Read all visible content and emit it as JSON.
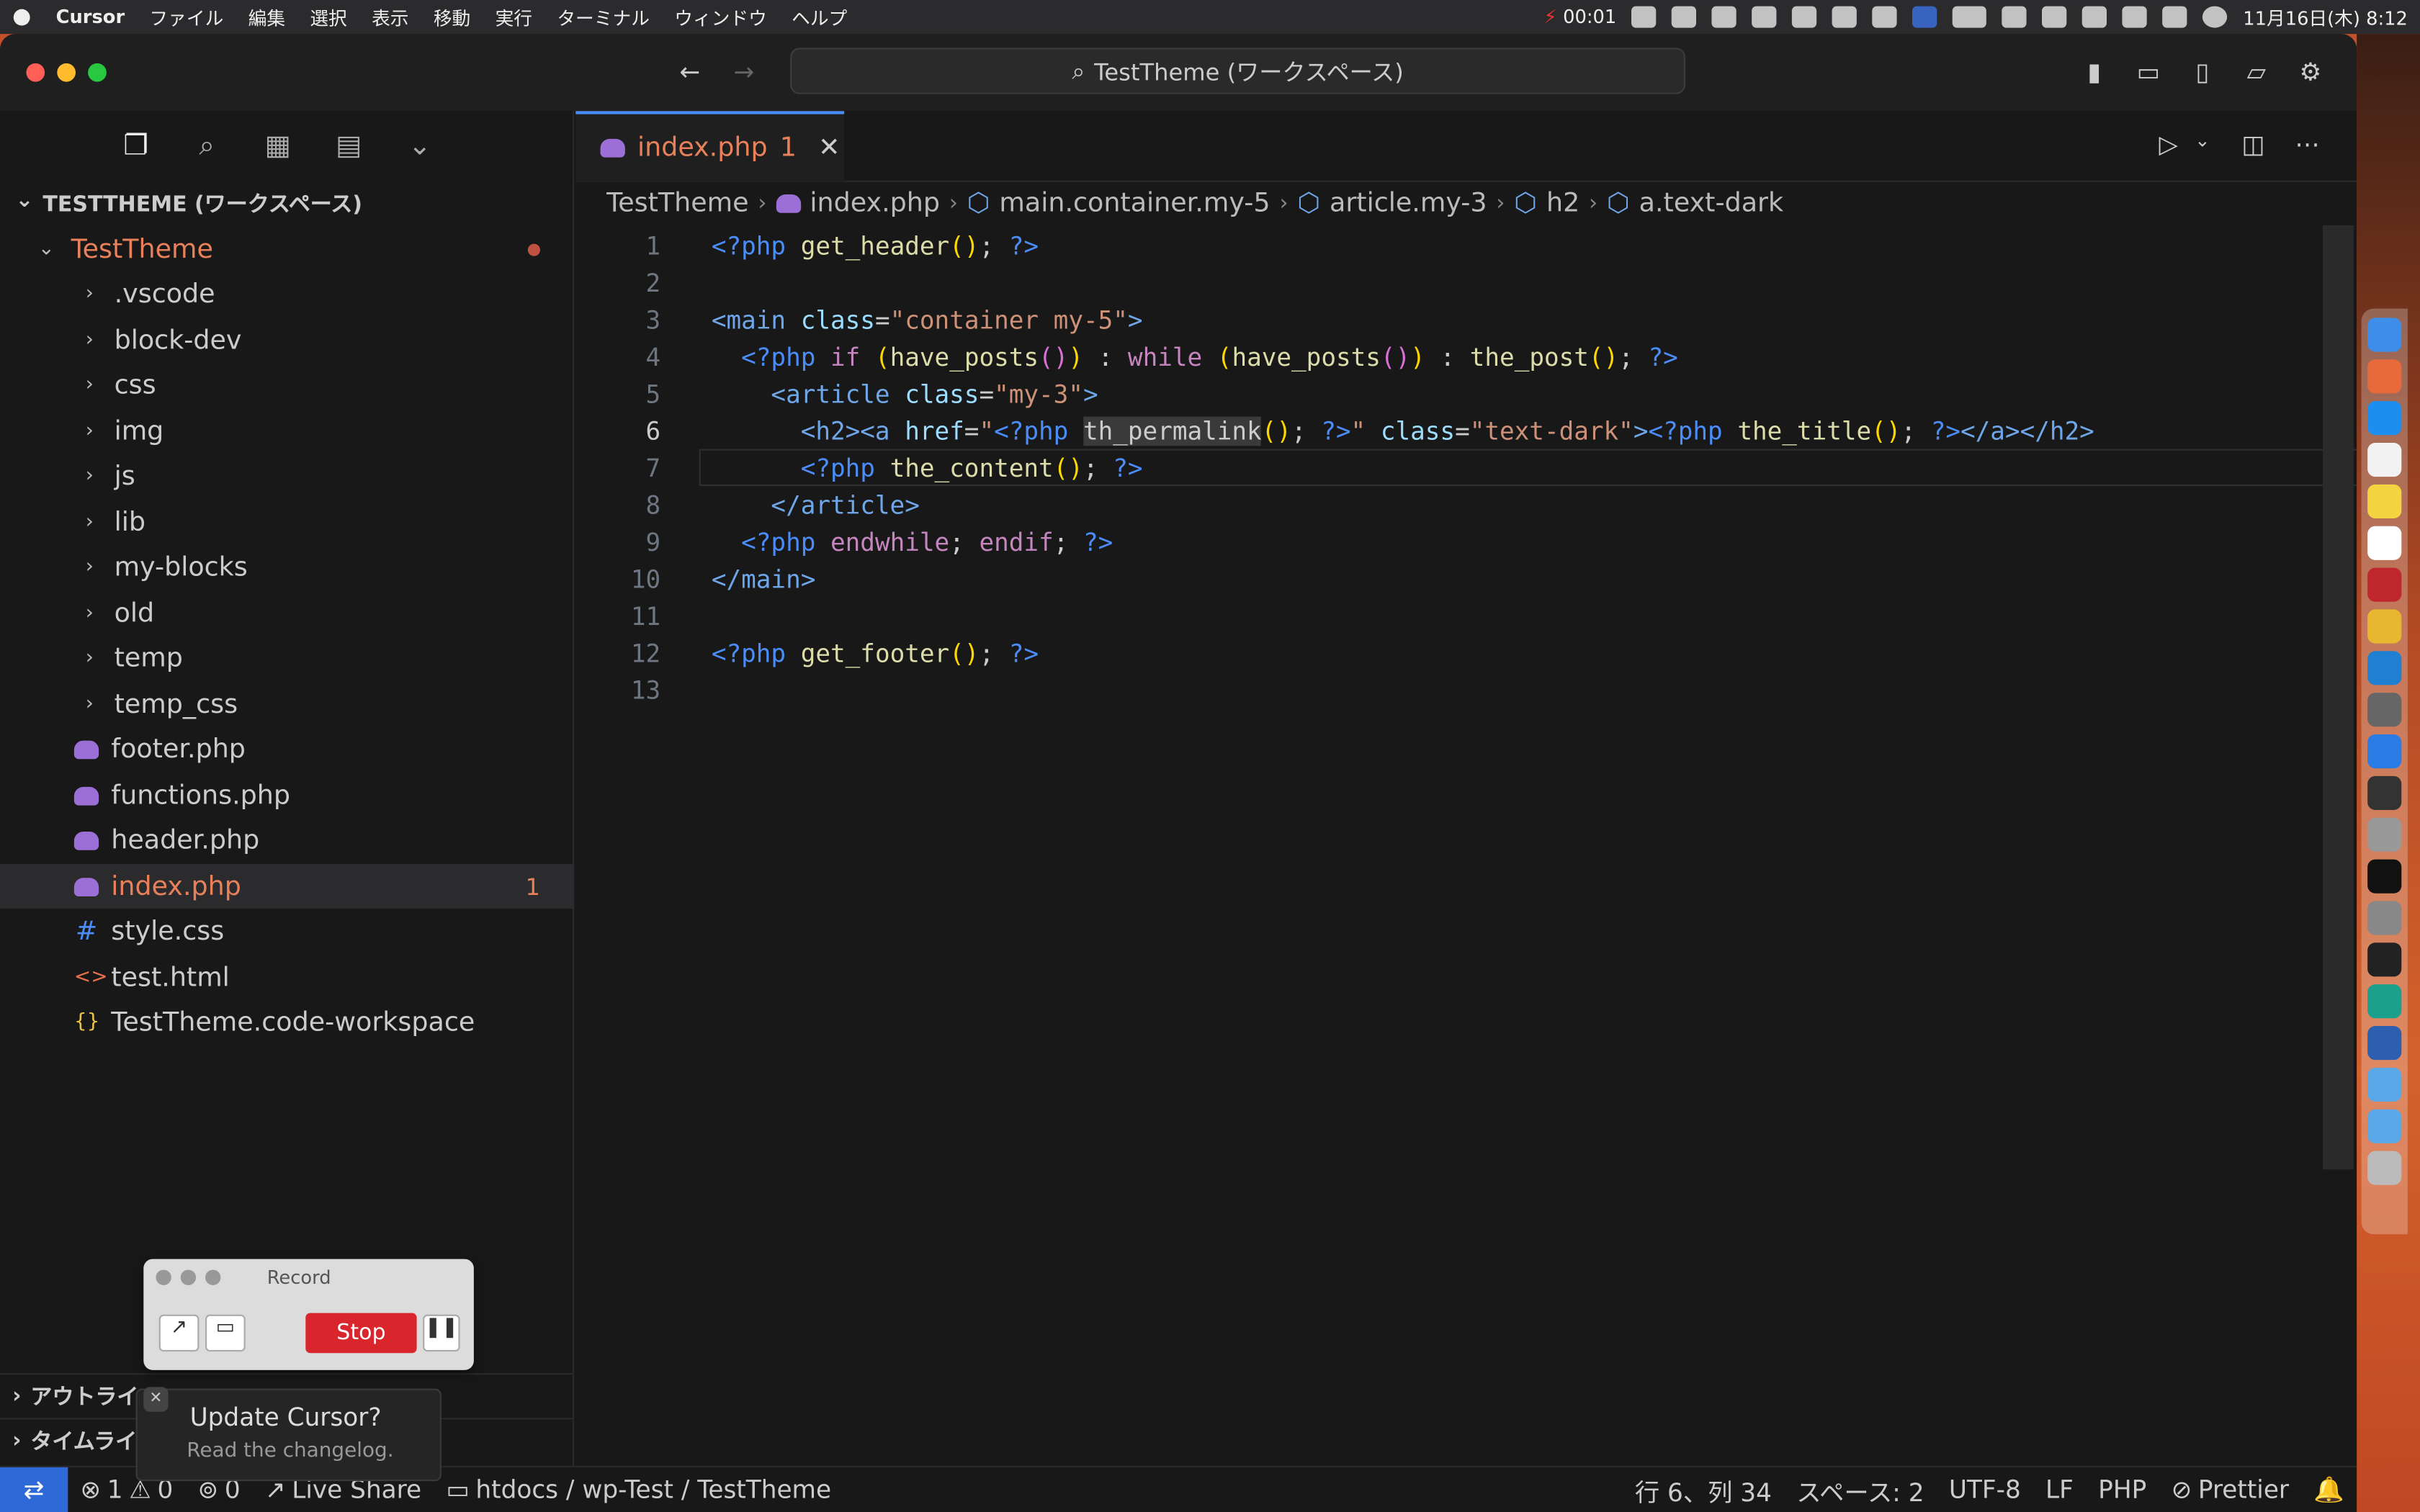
{
  "menubar": {
    "app_name": "Cursor",
    "items": [
      "ファイル",
      "編集",
      "選択",
      "表示",
      "移動",
      "実行",
      "ターミナル",
      "ウィンドウ",
      "ヘルプ"
    ],
    "timer": "00:01",
    "datetime": "11月16日(木) 8:12"
  },
  "titlebar": {
    "command_center": "TestTheme (ワークスペース)"
  },
  "sidebar": {
    "workspace_title": "TESTTHEME (ワークスペース)",
    "root_folder": "TestTheme",
    "folders": [
      ".vscode",
      "block-dev",
      "css",
      "img",
      "js",
      "lib",
      "my-blocks",
      "old",
      "temp",
      "temp_css"
    ],
    "files": [
      {
        "name": "footer.php",
        "icon": "php-icon"
      },
      {
        "name": "functions.php",
        "icon": "php-icon"
      },
      {
        "name": "header.php",
        "icon": "php-icon"
      },
      {
        "name": "index.php",
        "icon": "php-icon",
        "badge": "1"
      },
      {
        "name": "style.css",
        "icon": "css-icon"
      },
      {
        "name": "test.html",
        "icon": "html-icon"
      },
      {
        "name": "TestTheme.code-workspace",
        "icon": "json-icon"
      }
    ],
    "sections": [
      "アウトライ",
      "タイムライ"
    ]
  },
  "editor": {
    "tab_label": "index.php",
    "tab_badge": "1",
    "breadcrumbs": [
      "TestTheme",
      "index.php",
      "main.container.my-5",
      "article.my-3",
      "h2",
      "a.text-dark"
    ],
    "line_numbers": [
      "1",
      "2",
      "3",
      "4",
      "5",
      "6",
      "7",
      "8",
      "9",
      "10",
      "11",
      "12",
      "13"
    ],
    "current_line": 6
  },
  "record": {
    "title": "Record",
    "stop_label": "Stop"
  },
  "toast": {
    "title": "Update Cursor?",
    "subtitle": "Read the changelog."
  },
  "status": {
    "errors": "1",
    "warnings": "0",
    "ports": "0",
    "live_share": "Live Share",
    "path": "htdocs / wp-Test / TestTheme",
    "cursor_pos": "行 6、列 34",
    "spaces": "スペース: 2",
    "encoding": "UTF-8",
    "eol": "LF",
    "language": "PHP",
    "formatter": "Prettier"
  },
  "colors": {
    "accent": "#4b8df8",
    "modified": "#e8805a",
    "status_remote": "#2d6ad8"
  }
}
